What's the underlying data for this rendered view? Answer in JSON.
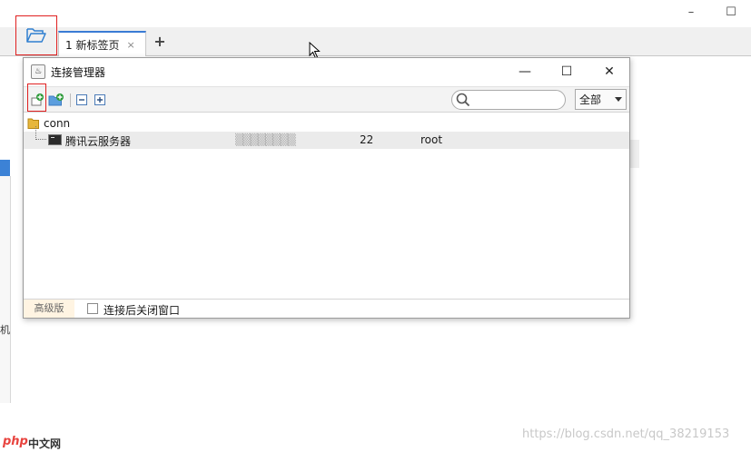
{
  "window": {
    "minimize_glyph": "–",
    "maximize_glyph": "☐"
  },
  "tabs": [
    {
      "label": "1 新标签页",
      "close_glyph": "×"
    }
  ],
  "tab_add_glyph": "+",
  "side_panel": {
    "partial_label": "机"
  },
  "dialog": {
    "title": "连接管理器",
    "icon_glyph": "♨",
    "controls": {
      "minimize": "—",
      "maximize": "☐",
      "close": "✕"
    },
    "toolbar": {
      "buttons": [
        "add-connection-icon",
        "add-folder-icon",
        "collapse-all-icon",
        "expand-all-icon"
      ],
      "search": {
        "value": "",
        "placeholder": ""
      },
      "filter": {
        "selected": "全部"
      }
    },
    "tree": {
      "group": "conn",
      "connections": [
        {
          "name": "腾讯云服务器",
          "host": "▒▒▒▒▒▒▒▒",
          "port": "22",
          "user": "root"
        }
      ]
    },
    "status": {
      "edition": "高级版",
      "close_after_connect": "连接后关闭窗口",
      "checked": false
    }
  },
  "watermark": "https://blog.csdn.net/qq_38219153",
  "logo": {
    "mark": "php",
    "text": "中文网"
  },
  "colors": {
    "accent": "#3a7bd5",
    "highlight_box": "#e02020",
    "edition_bg": "#fff4e2"
  }
}
